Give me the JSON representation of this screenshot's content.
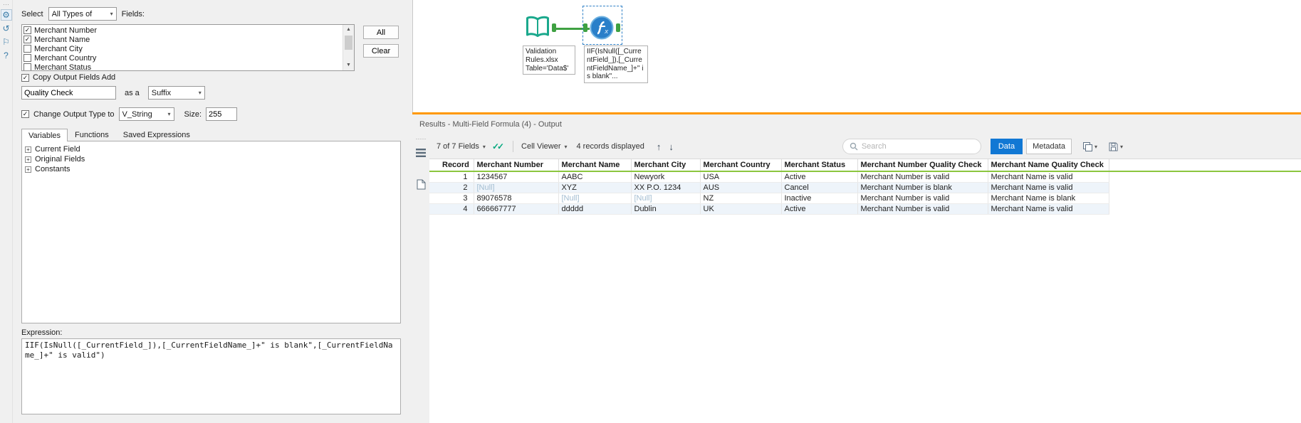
{
  "colors": {
    "selection_blue": "#1178d4",
    "connector_green": "#3fa142",
    "splitter_orange": "#ff9800",
    "grid_header_green": "#8cc63e",
    "null_text": "#a3bdd1"
  },
  "icons": {
    "gear": "⚙",
    "refresh": "↺",
    "tag": "⚐",
    "help": "?",
    "caret_down": "▾",
    "double_check": "✓✓",
    "up_arrow": "↑",
    "down_arrow": "↓",
    "scroll_up": "▲",
    "scroll_down": "▼",
    "check": "✓",
    "expander": "+"
  },
  "config": {
    "select_label": "Select",
    "field_type_dropdown": {
      "value": "All Types of"
    },
    "fields_label": "Fields:",
    "fields": [
      {
        "label": "Merchant Number",
        "checked": true
      },
      {
        "label": "Merchant Name",
        "checked": true
      },
      {
        "label": "Merchant City",
        "checked": false
      },
      {
        "label": "Merchant Country",
        "checked": false
      },
      {
        "label": "Merchant Status",
        "checked": false
      }
    ],
    "all_button": "All",
    "clear_button": "Clear",
    "copy_output_checkbox": {
      "label": "Copy Output Fields Add",
      "checked": true
    },
    "output_name": {
      "value": "Quality Check"
    },
    "as_a_label": "as a",
    "affix_dropdown": {
      "value": "Suffix"
    },
    "change_type_checkbox": {
      "label": "Change Output Type to",
      "checked": true
    },
    "output_type_dropdown": {
      "value": "V_String"
    },
    "size_label": "Size:",
    "size_value": "255",
    "tabs": [
      {
        "label": "Variables",
        "active": true
      },
      {
        "label": "Functions",
        "active": false
      },
      {
        "label": "Saved Expressions",
        "active": false
      }
    ],
    "tree_items": [
      "Current Field",
      "Original Fields",
      "Constants"
    ],
    "expression_label": "Expression:",
    "expression": "IIF(IsNull([_CurrentField_]),[_CurrentFieldName_]+\" is blank\",[_CurrentFieldName_]+\" is valid\")"
  },
  "canvas": {
    "tools": [
      {
        "name": "input-data-tool",
        "annotation": "Validation Rules.xlsx Table='Data$'"
      },
      {
        "name": "multi-field-formula-tool",
        "annotation": "IIF(IsNull([_CurrentField_]),[_CurrentFieldName_]+\" is blank\"...",
        "selected": true
      }
    ]
  },
  "results": {
    "title": "Results - Multi-Field Formula (4) - Output",
    "toolbar": {
      "fields_summary": "7 of 7 Fields",
      "cell_viewer": "Cell Viewer",
      "records_displayed": "4 records displayed",
      "search_placeholder": "Search",
      "data_button": "Data",
      "metadata_button": "Metadata"
    },
    "table": {
      "columns": [
        "Record",
        "Merchant Number",
        "Merchant Name",
        "Merchant City",
        "Merchant Country",
        "Merchant Status",
        "Merchant Number Quality Check",
        "Merchant Name Quality Check"
      ],
      "rows": [
        [
          "1",
          "1234567",
          "AABC",
          "Newyork",
          "USA",
          "Active",
          "Merchant Number is valid",
          "Merchant Name is valid"
        ],
        [
          "2",
          "[Null]",
          "XYZ",
          "XX P.O. 1234",
          "AUS",
          "Cancel",
          "Merchant Number is blank",
          "Merchant Name is valid"
        ],
        [
          "3",
          "89076578",
          "[Null]",
          "[Null]",
          "NZ",
          "Inactive",
          "Merchant Number is valid",
          "Merchant Name is blank"
        ],
        [
          "4",
          "666667777",
          "ddddd",
          "Dublin",
          "UK",
          "Active",
          "Merchant Number is valid",
          "Merchant Name is valid"
        ]
      ]
    }
  }
}
